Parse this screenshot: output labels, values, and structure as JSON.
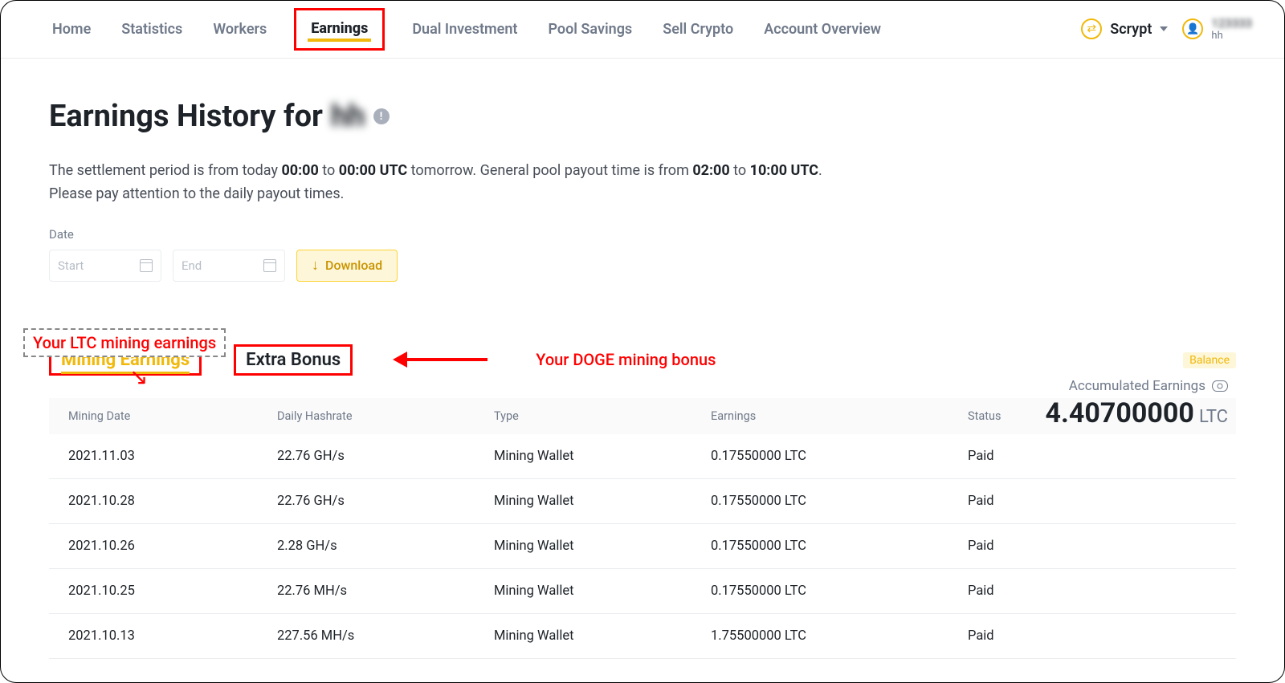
{
  "nav": {
    "items": [
      "Home",
      "Statistics",
      "Workers",
      "Earnings",
      "Dual Investment",
      "Pool Savings",
      "Sell Crypto",
      "Account Overview"
    ],
    "active_index": 3,
    "algo": "Scrypt",
    "user_line1": "123333",
    "user_line2": "hh"
  },
  "page": {
    "title_prefix": "Earnings History for ",
    "title_user": "hh",
    "desc_parts": {
      "a": "The settlement period is from today ",
      "b": "00:00",
      "c": " to ",
      "d": "00:00 UTC",
      "e": " tomorrow. General pool payout time is from ",
      "f": "02:00",
      "g": " to ",
      "h": "10:00 UTC",
      "i": ".",
      "j": "Please pay attention to the daily payout times."
    },
    "date_label": "Date",
    "start_placeholder": "Start",
    "end_placeholder": "End",
    "download_label": "Download"
  },
  "annotations": {
    "ltc_callout": "Your LTC mining earnings",
    "doge_callout": "Your DOGE mining bonus"
  },
  "tabs": {
    "mining": "Mining Earnings",
    "extra": "Extra Bonus"
  },
  "summary": {
    "balance_pill": "Balance",
    "acc_label": "Accumulated Earnings",
    "acc_value": "4.40700000",
    "acc_unit": "LTC"
  },
  "table": {
    "headers": [
      "Mining Date",
      "Daily Hashrate",
      "Type",
      "Earnings",
      "Status"
    ],
    "rows": [
      {
        "date": "2021.11.03",
        "hash": "22.76 GH/s",
        "type": "Mining Wallet",
        "earn": "0.17550000 LTC",
        "status": "Paid"
      },
      {
        "date": "2021.10.28",
        "hash": "22.76 GH/s",
        "type": "Mining Wallet",
        "earn": "0.17550000 LTC",
        "status": "Paid"
      },
      {
        "date": "2021.10.26",
        "hash": "2.28 GH/s",
        "type": "Mining Wallet",
        "earn": "0.17550000 LTC",
        "status": "Paid"
      },
      {
        "date": "2021.10.25",
        "hash": "22.76 MH/s",
        "type": "Mining Wallet",
        "earn": "0.17550000 LTC",
        "status": "Paid"
      },
      {
        "date": "2021.10.13",
        "hash": "227.56 MH/s",
        "type": "Mining Wallet",
        "earn": "1.75500000 LTC",
        "status": "Paid"
      }
    ]
  }
}
